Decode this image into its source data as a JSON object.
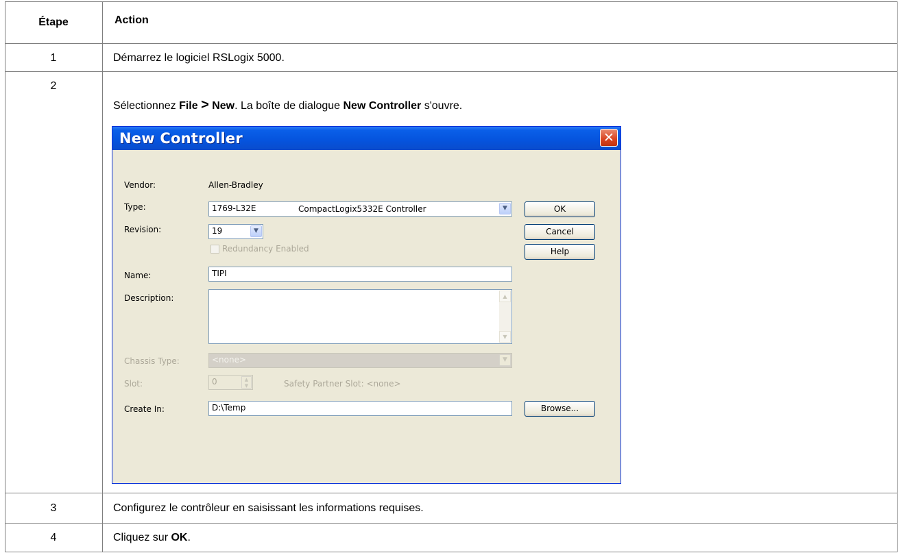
{
  "table": {
    "header": {
      "step": "Étape",
      "action": "Action"
    },
    "rows": [
      {
        "step": "1",
        "text": "Démarrez le logiciel RSLogix 5000."
      },
      {
        "step": "2",
        "intro_prefix": "Sélectionnez ",
        "intro_file": "File",
        "intro_gt": ">",
        "intro_new": "New",
        "intro_mid": ". La boîte de dialogue ",
        "intro_dialog": "New Controller",
        "intro_suffix": " s'ouvre."
      },
      {
        "step": "3",
        "text": "Configurez le contrôleur en saisissant les informations requises."
      },
      {
        "step": "4",
        "text_prefix": "Cliquez sur ",
        "text_bold": "OK",
        "text_suffix": "."
      }
    ]
  },
  "dialog": {
    "title": "New Controller",
    "close_glyph": "✕",
    "vendor_label": "Vendor:",
    "vendor_value": "Allen-Bradley",
    "type_label": "Type:",
    "type_code": "1769-L32E",
    "type_desc": "CompactLogix5332E Controller",
    "revision_label": "Revision:",
    "revision_value": "19",
    "redundancy_label": "Redundancy Enabled",
    "name_label": "Name:",
    "name_value": "TIPI",
    "description_label": "Description:",
    "description_value": "",
    "chassis_label": "Chassis Type:",
    "chassis_value": "<none>",
    "slot_label": "Slot:",
    "slot_value": "0",
    "safety_slot": "Safety Partner Slot: <none>",
    "create_in_label": "Create In:",
    "create_in_value": "D:\\Temp",
    "buttons": {
      "ok": "OK",
      "cancel": "Cancel",
      "help": "Help",
      "browse": "Browse..."
    },
    "dropdown_glyph": "▼",
    "scroll_up_glyph": "▲",
    "scroll_down_glyph": "▼"
  }
}
